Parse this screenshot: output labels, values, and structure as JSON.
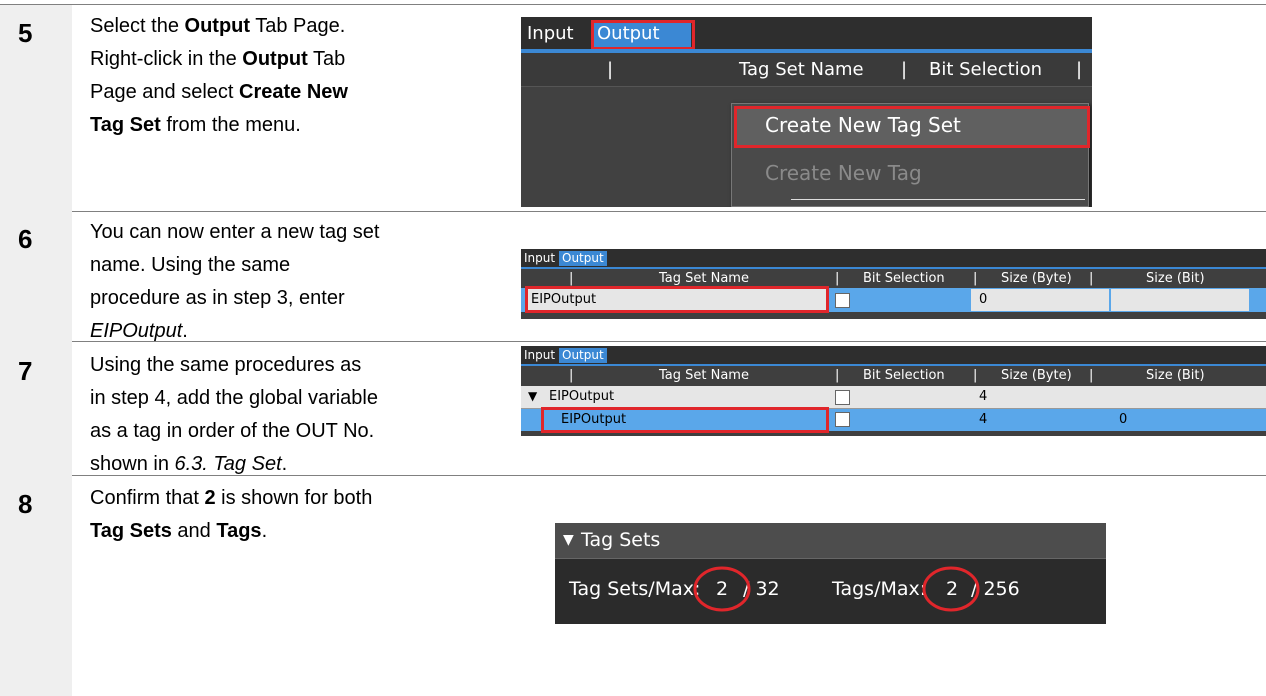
{
  "steps": [
    {
      "number": "5",
      "lines": [
        [
          {
            "t": "Select the "
          },
          {
            "b": "Output"
          },
          {
            "t": " Tab Page."
          }
        ],
        [
          {
            "t": "Right-click in the "
          },
          {
            "b": "Output"
          },
          {
            "t": " Tab"
          }
        ],
        [
          {
            "t": "Page and select "
          },
          {
            "b": "Create New"
          }
        ],
        [
          {
            "b": "Tag Set"
          },
          {
            "t": " from the menu."
          }
        ]
      ]
    },
    {
      "number": "6",
      "lines": [
        [
          {
            "t": "You can now enter a new tag set"
          }
        ],
        [
          {
            "t": "name. Using the same"
          }
        ],
        [
          {
            "t": "procedure as in step 3, enter"
          }
        ],
        [
          {
            "i": "EIPOutput"
          },
          {
            "t": "."
          }
        ]
      ]
    },
    {
      "number": "7",
      "lines": [
        [
          {
            "t": "Using the same procedures as"
          }
        ],
        [
          {
            "t": "in step 4, add the global variable"
          }
        ],
        [
          {
            "t": "as a tag in order of the OUT No."
          }
        ],
        [
          {
            "t": "shown in "
          },
          {
            "i": "6.3. Tag Set"
          },
          {
            "t": "."
          }
        ]
      ]
    },
    {
      "number": "8",
      "lines": [
        [
          {
            "t": "Confirm that "
          },
          {
            "b": "2"
          },
          {
            "t": " is shown for both"
          }
        ],
        [
          {
            "b": "Tag Sets"
          },
          {
            "t": " and "
          },
          {
            "b": "Tags"
          },
          {
            "t": "."
          }
        ]
      ]
    }
  ],
  "tabs": {
    "input": "Input",
    "output": "Output"
  },
  "columns": {
    "sep": "|",
    "tag_set_name": "Tag Set Name",
    "bit_selection": "Bit Selection",
    "size_byte": "Size (Byte)",
    "size_bit": "Size (Bit)"
  },
  "menu": {
    "create_new_tag_set": "Create New Tag Set",
    "create_new_tag": "Create New Tag"
  },
  "shot6": {
    "row_name": "EIPOutput",
    "row_size_byte": "0"
  },
  "shot7": {
    "expand_glyph": "▼",
    "set_name": "EIPOutput",
    "set_size_byte": "4",
    "tag_name": "EIPOutput",
    "tag_size_byte": "4",
    "tag_size_bit": "0"
  },
  "shot8": {
    "header": "Tag Sets",
    "header_glyph": "▼",
    "tagsets_label": "Tag Sets/Max:",
    "tagsets_value": "2",
    "tagsets_max": "/  32",
    "tags_label": "Tags/Max:",
    "tags_value": "2",
    "tags_max": "/  256"
  },
  "colors": {
    "selected_tab": "#3b88d4",
    "highlight_red": "#e0262b",
    "ui_dark": "#2e2e2e",
    "row_blue": "#5aa7ea"
  }
}
